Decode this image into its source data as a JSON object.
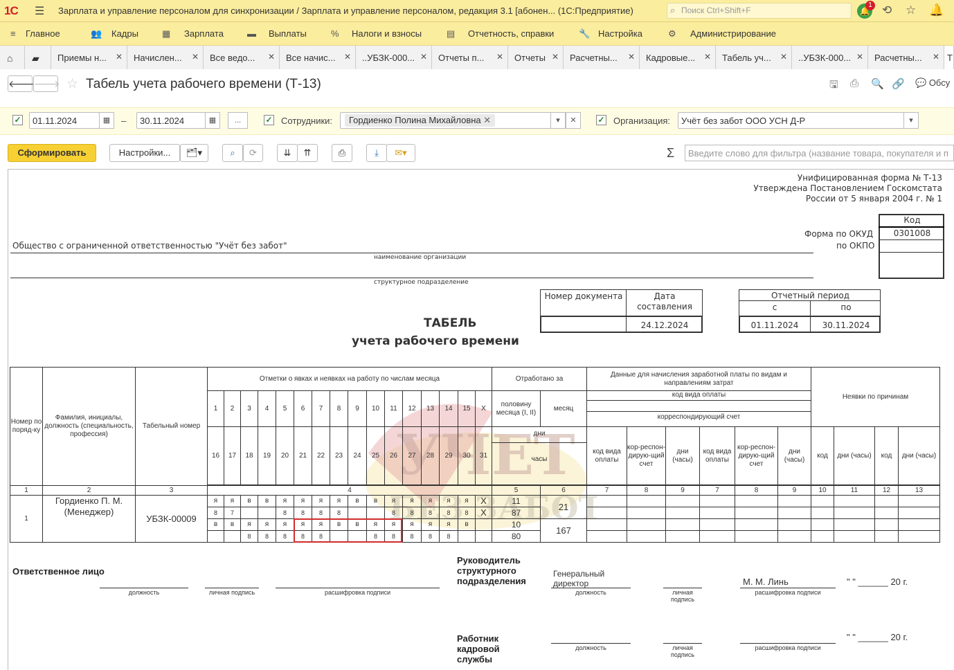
{
  "app": {
    "logo": "1С",
    "title": "Зарплата и управление персоналом для синхронизации / Зарплата и управление персоналом, редакция 3.1 [абонен... (1С:Предприятие)",
    "search_placeholder": "Поиск Ctrl+Shift+F",
    "notifications": "1"
  },
  "menu": [
    {
      "label": "Главное",
      "icon": "≡"
    },
    {
      "label": "Кадры",
      "icon": "👥"
    },
    {
      "label": "Зарплата",
      "icon": "▦"
    },
    {
      "label": "Выплаты",
      "icon": "▬"
    },
    {
      "label": "Налоги и взносы",
      "icon": "%"
    },
    {
      "label": "Отчетность, справки",
      "icon": "▤"
    },
    {
      "label": "Настройка",
      "icon": "🔧"
    },
    {
      "label": "Администрирование",
      "icon": "⚙"
    }
  ],
  "tabs": [
    "Приемы н...",
    "Начислен...",
    "Все ведо...",
    "Все начис...",
    "..УБЗК-000...",
    "Отчеты п...",
    "Отчеты",
    "Расчетны...",
    "Кадровые...",
    "Табель уч...",
    "..УБЗК-000...",
    "Расчетны...",
    "Т"
  ],
  "form": {
    "title": "Табель учета рабочего времени (Т-13)",
    "discuss": "Обсу"
  },
  "filters": {
    "date_from": "01.11.2024",
    "date_dash": "–",
    "date_to": "30.11.2024",
    "more": "...",
    "employees_label": "Сотрудники:",
    "employee": "Гордиенко Полина Михайловна",
    "org_label": "Организация:",
    "org": "Учёт без забот ООО УСН Д-Р"
  },
  "commands": {
    "generate": "Сформировать",
    "settings": "Настройки...",
    "filter_placeholder": "Введите слово для фильтра (название товара, покупателя и п"
  },
  "report": {
    "form_no": "Унифицированная форма № Т-13",
    "approved1": "Утверждена Постановлением Госкомстата",
    "approved2": "России от 5 января 2004 г. № 1",
    "code_h": "Код",
    "okud_l": "Форма по ОКУД",
    "okud": "0301008",
    "okpo_l": "по ОКПО",
    "org": "Общество с ограниченной ответственностью \"Учёт без забот\"",
    "org_cap": "наименование организации",
    "dept_cap": "структурное подразделение",
    "docno_h": "Номер документа",
    "date_h": "Дата составления",
    "date": "24.12.2024",
    "period_h": "Отчетный период",
    "from_h": "с",
    "to_h": "по",
    "from": "01.11.2024",
    "to": "30.11.2024",
    "t1": "ТАБЕЛЬ",
    "t2": "учета  рабочего времени",
    "h_num": "Номер по поряд-ку",
    "h_fio": "Фамилия, инициалы, должность (специальность, профессия)",
    "h_tab": "Табельный номер",
    "h_marks": "Отметки о явках и неявках на работу по числам месяца",
    "h_worked": "Отработано за",
    "h_half": "половину месяца (I, II)",
    "h_month": "месяц",
    "h_days": "дни",
    "h_hours": "часы",
    "h_pay": "Данные для начисления заработной платы по видам и направлениям затрат",
    "h_paycode": "код вида оплаты",
    "h_corr": "корреспондирующий счет",
    "h_vid": "код вида оплаты",
    "h_kor": "кор-респон-дирую-щий счет",
    "h_dni": "дни (часы)",
    "h_abs": "Неявки по причинам",
    "h_code": "код",
    "x": "X",
    "days1": [
      "1",
      "2",
      "3",
      "4",
      "5",
      "6",
      "7",
      "8",
      "9",
      "10",
      "11",
      "12",
      "13",
      "14",
      "15"
    ],
    "days2": [
      "16",
      "17",
      "18",
      "19",
      "20",
      "21",
      "22",
      "23",
      "24",
      "25",
      "26",
      "27",
      "28",
      "29",
      "30",
      "31"
    ],
    "colnums": [
      "1",
      "2",
      "3",
      "4",
      "5",
      "6",
      "7",
      "8",
      "9",
      "7",
      "8",
      "9",
      "10",
      "11",
      "12",
      "13"
    ],
    "emp_no": "1",
    "emp_name": "Гордиенко П. М. (Менеджер)",
    "emp_tab": "УБЗК-00009",
    "r1": [
      "я",
      "я",
      "в",
      "в",
      "я",
      "я",
      "я",
      "я",
      "в",
      "в",
      "я",
      "я",
      "я",
      "я",
      "я"
    ],
    "r2": [
      "8",
      "7",
      "",
      "",
      "8",
      "8",
      "8",
      "8",
      "",
      "",
      "8",
      "8",
      "8",
      "8",
      "8"
    ],
    "r3": [
      "в",
      "в",
      "я",
      "я",
      "я",
      "я",
      "я",
      "в",
      "в",
      "я",
      "я",
      "я",
      "я",
      "я",
      "в",
      ""
    ],
    "r4": [
      "",
      "",
      "8",
      "8",
      "8",
      "8",
      "8",
      "",
      "",
      "8",
      "8",
      "8",
      "8",
      "8",
      "",
      ""
    ],
    "half1_days": "11",
    "half1_hours": "87",
    "half2_days": "10",
    "half2_hours": "80",
    "month_days": "21",
    "month_hours": "167",
    "resp": "Ответственное лицо",
    "pos_cap": "должность",
    "sign_cap": "личная подпись",
    "decode_cap": "расшифровка подписи",
    "head": "Руководитель структурного подразделения",
    "head_pos": "Генеральный директор",
    "head_name": "М. М. Линь",
    "date_tpl": "\" \" ______ 20    г.",
    "hr": "Работник кадровой службы"
  }
}
